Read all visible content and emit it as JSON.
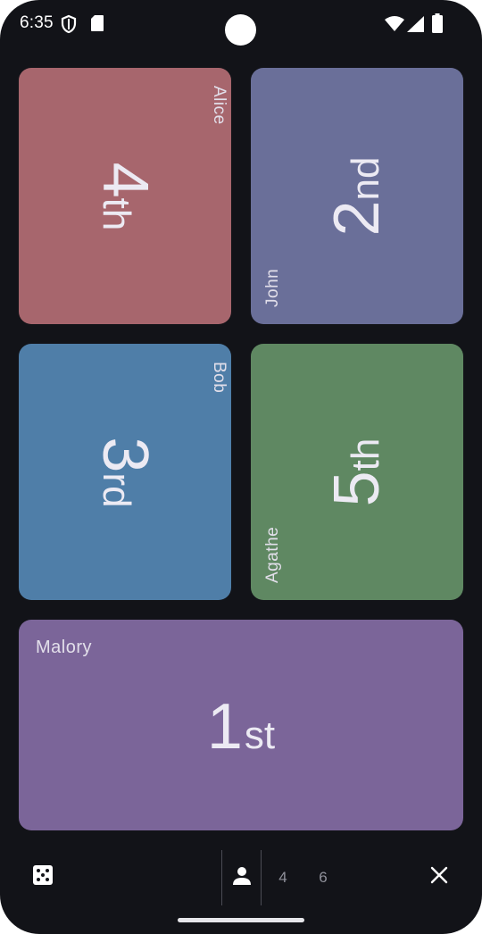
{
  "status_bar": {
    "time": "6:35",
    "icons": [
      "shield-icon",
      "sd-card-icon",
      "wifi-icon",
      "signal-icon",
      "battery-icon"
    ]
  },
  "players": [
    {
      "name": "Alice",
      "rank_number": "4",
      "rank_suffix": "th",
      "color": "#a7666d"
    },
    {
      "name": "John",
      "rank_number": "2",
      "rank_suffix": "nd",
      "color": "#6a6f99"
    },
    {
      "name": "Bob",
      "rank_number": "3",
      "rank_suffix": "rd",
      "color": "#4f7ea8"
    },
    {
      "name": "Agathe",
      "rank_number": "5",
      "rank_suffix": "th",
      "color": "#5f8862"
    },
    {
      "name": "Malory",
      "rank_number": "1",
      "rank_suffix": "st",
      "color": "#7b6599"
    }
  ],
  "bottom_bar": {
    "dice_icon": "dice-icon",
    "player_icon": "person-icon",
    "count_options": [
      "4",
      "6"
    ],
    "close_icon": "close-icon"
  },
  "colors": {
    "background": "#121318"
  }
}
